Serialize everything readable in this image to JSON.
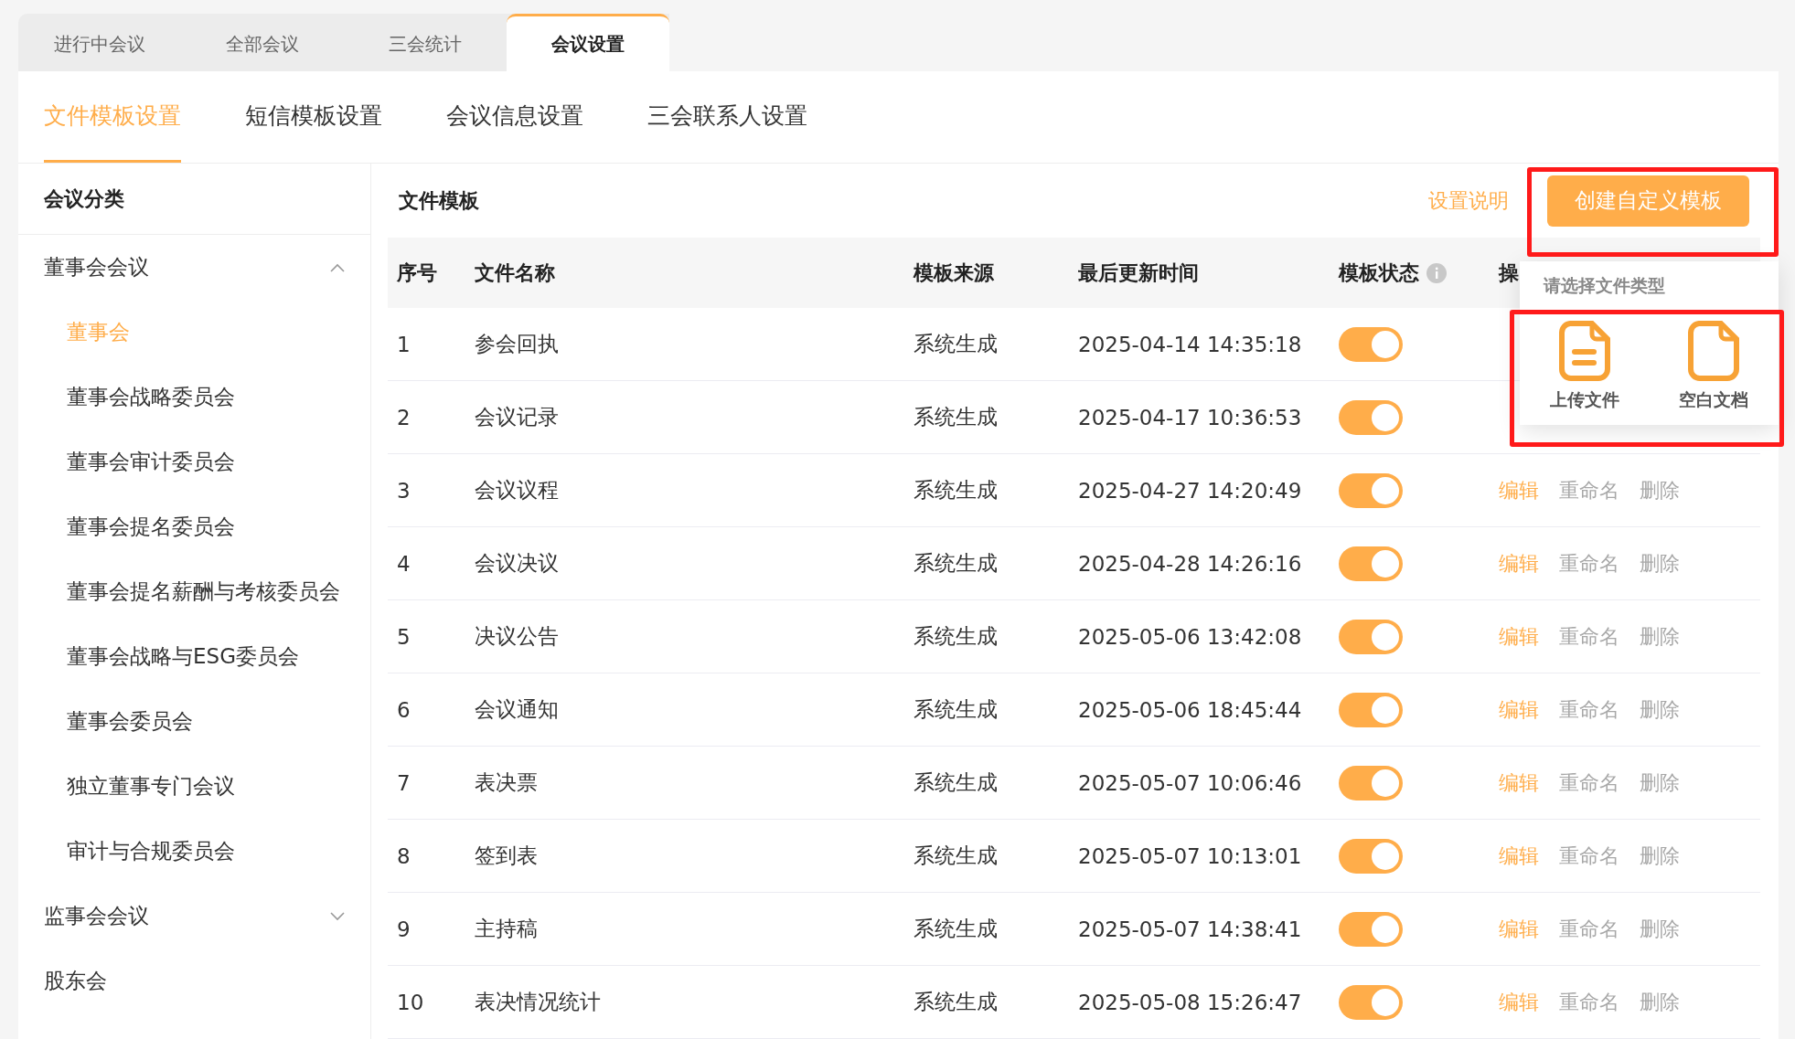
{
  "top_tabs": [
    {
      "label": "进行中会议",
      "selected": false
    },
    {
      "label": "全部会议",
      "selected": false
    },
    {
      "label": "三会统计",
      "selected": false
    },
    {
      "label": "会议设置",
      "selected": true
    }
  ],
  "sub_tabs": [
    {
      "label": "文件模板设置",
      "selected": true
    },
    {
      "label": "短信模板设置",
      "selected": false
    },
    {
      "label": "会议信息设置",
      "selected": false
    },
    {
      "label": "三会联系人设置",
      "selected": false
    }
  ],
  "sidebar": {
    "title": "会议分类",
    "items": [
      {
        "label": "董事会会议",
        "expanded": true,
        "children": [
          {
            "label": "董事会",
            "selected": true
          },
          {
            "label": "董事会战略委员会",
            "selected": false
          },
          {
            "label": "董事会审计委员会",
            "selected": false
          },
          {
            "label": "董事会提名委员会",
            "selected": false
          },
          {
            "label": "董事会提名薪酬与考核委员会",
            "selected": false
          },
          {
            "label": "董事会战略与ESG委员会",
            "selected": false
          },
          {
            "label": "董事会委员会",
            "selected": false
          },
          {
            "label": "独立董事专门会议",
            "selected": false
          },
          {
            "label": "审计与合规委员会",
            "selected": false
          }
        ]
      },
      {
        "label": "监事会会议",
        "expanded": false
      },
      {
        "label": "股东会"
      }
    ]
  },
  "main": {
    "title": "文件模板",
    "help_link": "设置说明",
    "create_button": "创建自定义模板"
  },
  "table": {
    "columns": [
      "序号",
      "文件名称",
      "模板来源",
      "最后更新时间",
      "模板状态",
      "操"
    ],
    "rows": [
      {
        "index": "1",
        "name": "参会回执",
        "source": "系统生成",
        "updated": "2025-04-14 14:35:18",
        "on": true
      },
      {
        "index": "2",
        "name": "会议记录",
        "source": "系统生成",
        "updated": "2025-04-17 10:36:53",
        "on": true
      },
      {
        "index": "3",
        "name": "会议议程",
        "source": "系统生成",
        "updated": "2025-04-27 14:20:49",
        "on": true,
        "actions": [
          {
            "label": "编辑",
            "disabled": false
          },
          {
            "label": "重命名",
            "disabled": true
          },
          {
            "label": "删除",
            "disabled": true
          }
        ]
      },
      {
        "index": "4",
        "name": "会议决议",
        "source": "系统生成",
        "updated": "2025-04-28 14:26:16",
        "on": true,
        "actions": [
          {
            "label": "编辑",
            "disabled": false
          },
          {
            "label": "重命名",
            "disabled": true
          },
          {
            "label": "删除",
            "disabled": true
          }
        ]
      },
      {
        "index": "5",
        "name": "决议公告",
        "source": "系统生成",
        "updated": "2025-05-06 13:42:08",
        "on": true,
        "actions": [
          {
            "label": "编辑",
            "disabled": false
          },
          {
            "label": "重命名",
            "disabled": true
          },
          {
            "label": "删除",
            "disabled": true
          }
        ]
      },
      {
        "index": "6",
        "name": "会议通知",
        "source": "系统生成",
        "updated": "2025-05-06 18:45:44",
        "on": true,
        "actions": [
          {
            "label": "编辑",
            "disabled": false
          },
          {
            "label": "重命名",
            "disabled": true
          },
          {
            "label": "删除",
            "disabled": true
          }
        ]
      },
      {
        "index": "7",
        "name": "表决票",
        "source": "系统生成",
        "updated": "2025-05-07 10:06:46",
        "on": true,
        "actions": [
          {
            "label": "编辑",
            "disabled": false
          },
          {
            "label": "重命名",
            "disabled": true
          },
          {
            "label": "删除",
            "disabled": true
          }
        ]
      },
      {
        "index": "8",
        "name": "签到表",
        "source": "系统生成",
        "updated": "2025-05-07 10:13:01",
        "on": true,
        "actions": [
          {
            "label": "编辑",
            "disabled": false
          },
          {
            "label": "重命名",
            "disabled": true
          },
          {
            "label": "删除",
            "disabled": true
          }
        ]
      },
      {
        "index": "9",
        "name": "主持稿",
        "source": "系统生成",
        "updated": "2025-05-07 14:38:41",
        "on": true,
        "actions": [
          {
            "label": "编辑",
            "disabled": false
          },
          {
            "label": "重命名",
            "disabled": true
          },
          {
            "label": "删除",
            "disabled": true
          }
        ]
      },
      {
        "index": "10",
        "name": "表决情况统计",
        "source": "系统生成",
        "updated": "2025-05-08 15:26:47",
        "on": true,
        "actions": [
          {
            "label": "编辑",
            "disabled": false
          },
          {
            "label": "重命名",
            "disabled": true
          },
          {
            "label": "删除",
            "disabled": true
          }
        ]
      }
    ]
  },
  "popover": {
    "title": "请选择文件类型",
    "options": [
      {
        "kind": "upload",
        "label": "上传文件"
      },
      {
        "kind": "blank",
        "label": "空白文档"
      }
    ]
  }
}
